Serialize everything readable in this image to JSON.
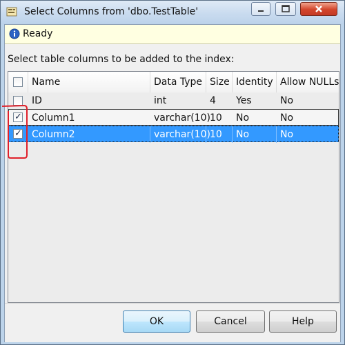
{
  "window": {
    "title": "Select Columns from 'dbo.TestTable'"
  },
  "status": {
    "text": "Ready",
    "icon": "info-icon"
  },
  "instruction": "Select table columns to be added to the index:",
  "grid": {
    "columns": [
      "Name",
      "Data Type",
      "Size",
      "Identity",
      "Allow NULLs"
    ],
    "header_checked": false,
    "rows": [
      {
        "checked": false,
        "name": "ID",
        "data_type": "int",
        "size": "4",
        "identity": "Yes",
        "allow_nulls": "No"
      },
      {
        "checked": true,
        "name": "Column1",
        "data_type": "varchar(10)",
        "size": "10",
        "identity": "No",
        "allow_nulls": "No"
      },
      {
        "checked": true,
        "name": "Column2",
        "data_type": "varchar(10)",
        "size": "10",
        "identity": "No",
        "allow_nulls": "No"
      }
    ],
    "selected_row": 2
  },
  "buttons": {
    "ok": "OK",
    "cancel": "Cancel",
    "help": "Help"
  },
  "colors": {
    "selection": "#3399ff",
    "annotation": "#e0202a",
    "status_background": "#ffffe1"
  }
}
